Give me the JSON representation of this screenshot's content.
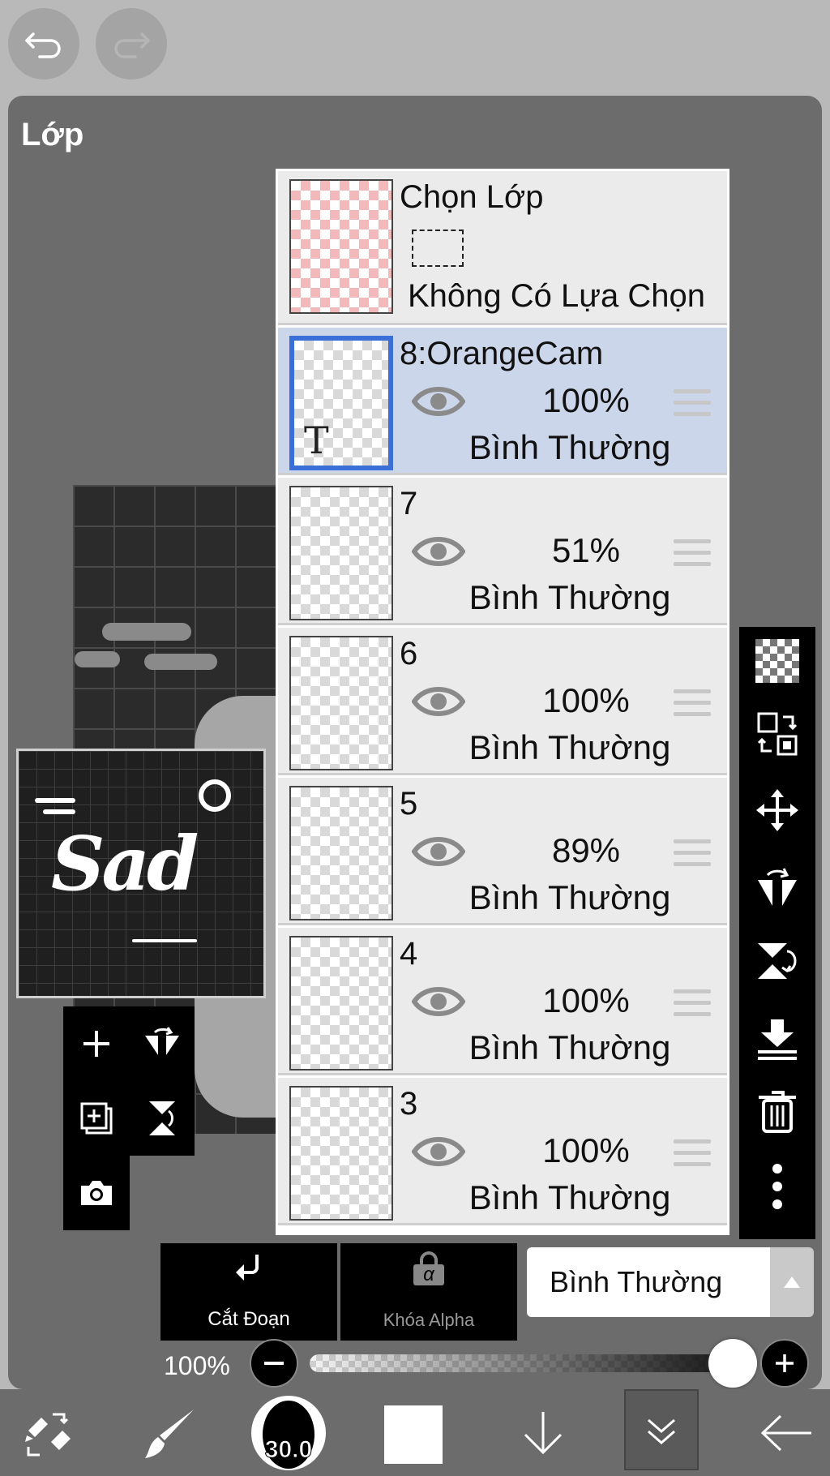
{
  "panel": {
    "title": "Lớp"
  },
  "selection_layer": {
    "title": "Chọn Lớp",
    "status": "Không Có Lựa Chọn"
  },
  "layers": [
    {
      "name": "8:OrangeCam",
      "opacity": "100%",
      "blend": "Bình Thường",
      "selected": true,
      "thumb_label": "T"
    },
    {
      "name": "7",
      "opacity": "51%",
      "blend": "Bình Thường"
    },
    {
      "name": "6",
      "opacity": "100%",
      "blend": "Bình Thường"
    },
    {
      "name": "5",
      "opacity": "89%",
      "blend": "Bình Thường"
    },
    {
      "name": "4",
      "opacity": "100%",
      "blend": "Bình Thường"
    },
    {
      "name": "3",
      "opacity": "100%",
      "blend": "Bình Thường"
    }
  ],
  "thumbnail": {
    "word": "Sad"
  },
  "bottom_buttons": {
    "clip_label": "Cắt Đoạn",
    "alpha_lock_label": "Khóa Alpha",
    "alpha_symbol": "α"
  },
  "blend_mode": {
    "value": "Bình Thường"
  },
  "opacity": {
    "label": "100%",
    "value": 1.0
  },
  "toolbar": {
    "brush_size": "30.0"
  },
  "colors": {
    "panel": "#6c6c6c",
    "selected_layer": "#ccd6ea",
    "selected_border": "#3a6fd8",
    "selection_checker": "#f2b9bb"
  }
}
